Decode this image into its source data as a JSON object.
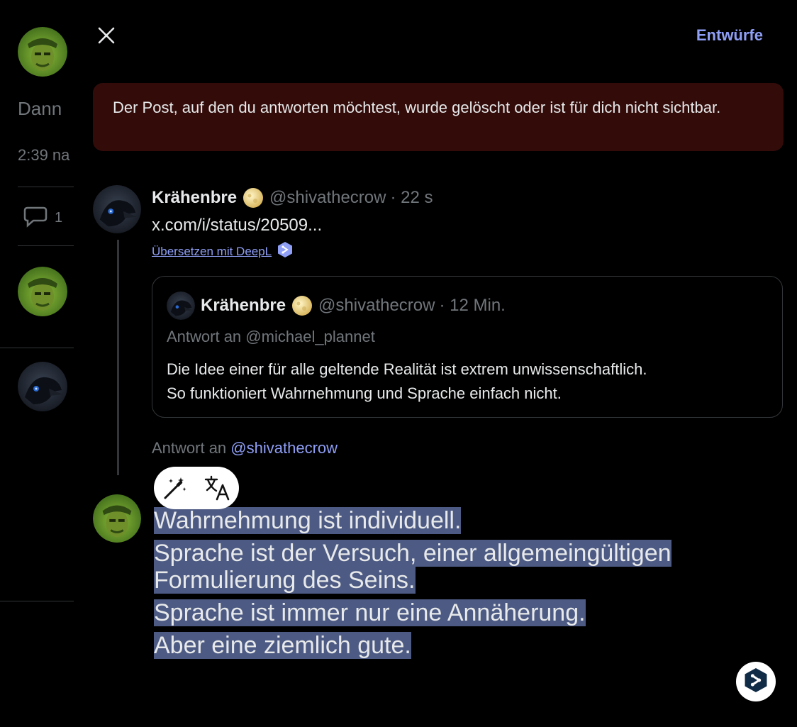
{
  "background": {
    "fragment_name": "Dann",
    "fragment_time": "2:39 na",
    "reply_count": "1"
  },
  "dialog": {
    "drafts_label": "Entwürfe",
    "error_message": "Der Post, auf den du antworten möchtest, wurde gelöscht oder ist für dich nicht sichtbar."
  },
  "tweet": {
    "name": "Krähenbre",
    "handle": "@shivathecrow",
    "time": "· 22 s",
    "link_text": "x.com/i/status/20509...",
    "translate_label": "Übersetzen mit DeepL"
  },
  "quote": {
    "name": "Krähenbre",
    "handle": "@shivathecrow",
    "time": "· 12 Min.",
    "reply_context": "Antwort an @michael_plannet",
    "body_line1": "Die Idee einer für alle geltende Realität ist extrem unwissenschaftlich.",
    "body_line2": "So funktioniert Wahrnehmung und Sprache einfach nicht."
  },
  "reply": {
    "prefix": "Antwort an",
    "mention": "@shivathecrow"
  },
  "compose": {
    "lines": [
      "Wahrnehmung ist individuell.",
      "Sprache ist der Versuch, einer allgemeingültigen",
      "Formulierung des Seins.",
      "Sprache ist immer nur eine Annäherung.",
      "Aber eine ziemlich gute."
    ]
  },
  "icons": {
    "close": "close-icon",
    "deepl": "deepl-icon",
    "magic": "magic-wand-icon",
    "translate": "translate-icon",
    "reply": "reply-bubble-icon",
    "badge": "moon-badge-icon"
  },
  "colors": {
    "accent": "#8f9ff6",
    "error_bg": "#330c0a",
    "selection": "#4d5a83",
    "muted": "#71767b"
  }
}
